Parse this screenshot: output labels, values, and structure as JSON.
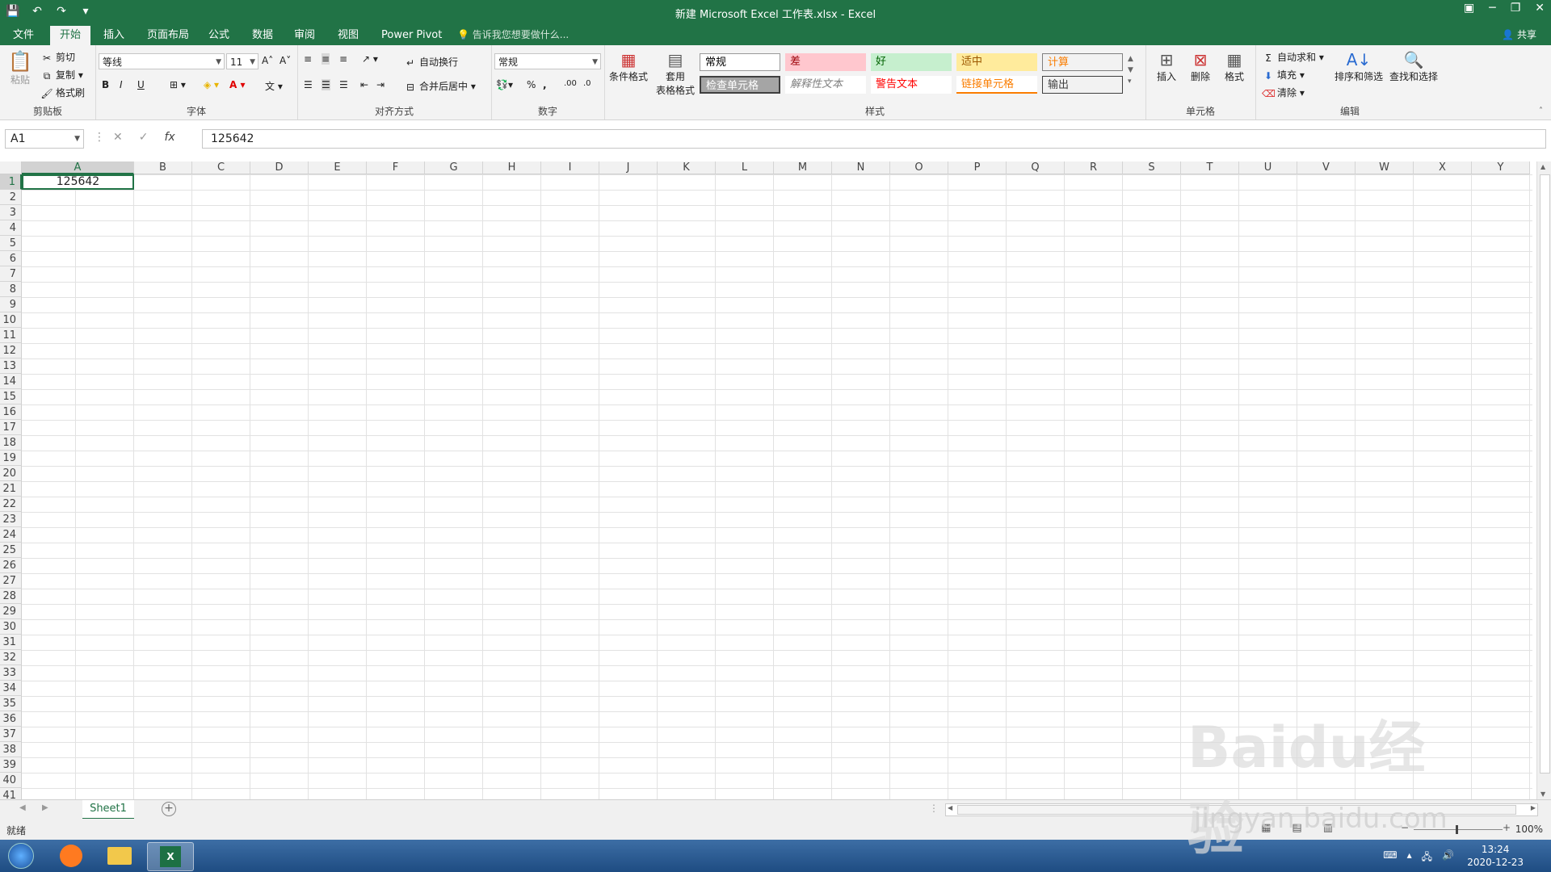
{
  "titlebar": {
    "title": "新建 Microsoft Excel 工作表.xlsx - Excel",
    "qat": [
      "save-icon",
      "undo-icon",
      "redo-icon",
      "customize-icon"
    ],
    "controls": [
      "ribbon-display-icon",
      "minimize-icon",
      "restore-icon",
      "close-icon"
    ]
  },
  "tabs": [
    {
      "label": "文件",
      "active": false
    },
    {
      "label": "开始",
      "active": true
    },
    {
      "label": "插入",
      "active": false
    },
    {
      "label": "页面布局",
      "active": false
    },
    {
      "label": "公式",
      "active": false
    },
    {
      "label": "数据",
      "active": false
    },
    {
      "label": "审阅",
      "active": false
    },
    {
      "label": "视图",
      "active": false
    },
    {
      "label": "Power Pivot",
      "active": false
    }
  ],
  "tellme": "告诉我您想要做什么...",
  "share": "共享",
  "ribbon": {
    "clipboard": {
      "label": "剪贴板",
      "paste": "粘贴",
      "cut": "剪切",
      "copy": "复制",
      "format_painter": "格式刷"
    },
    "font": {
      "label": "字体",
      "name": "等线",
      "size": "11",
      "bold": "B",
      "italic": "I",
      "underline": "U"
    },
    "alignment": {
      "label": "对齐方式",
      "wrap": "自动换行",
      "merge": "合并后居中"
    },
    "number": {
      "label": "数字",
      "format": "常规",
      "percent": "%",
      "comma": ","
    },
    "styles": {
      "label": "样式",
      "cond_format": "条件格式",
      "table_format_1": "套用",
      "table_format_2": "表格格式",
      "boxes": [
        {
          "text": "常规",
          "bg": "#ffffff",
          "fg": "#000000"
        },
        {
          "text": "差",
          "bg": "#ffc7ce",
          "fg": "#9c0006"
        },
        {
          "text": "好",
          "bg": "#c6efce",
          "fg": "#006100"
        },
        {
          "text": "适中",
          "bg": "#ffeb9c",
          "fg": "#9c5700"
        },
        {
          "text": "计算",
          "bg": "#f2f2f2",
          "fg": "#fa7d00"
        },
        {
          "text": "检查单元格",
          "bg": "#a5a5a5",
          "fg": "#ffffff"
        },
        {
          "text": "解释性文本",
          "bg": "#ffffff",
          "fg": "#7f7f7f"
        },
        {
          "text": "警告文本",
          "bg": "#ffffff",
          "fg": "#ff0000"
        },
        {
          "text": "链接单元格",
          "bg": "#ffffff",
          "fg": "#fa7d00"
        },
        {
          "text": "输出",
          "bg": "#f2f2f2",
          "fg": "#3f3f3f"
        }
      ]
    },
    "cells": {
      "label": "单元格",
      "insert": "插入",
      "delete": "删除",
      "format": "格式"
    },
    "editing": {
      "label": "编辑",
      "autosum": "自动求和",
      "fill": "填充",
      "clear": "清除",
      "sort": "排序和筛选",
      "find": "查找和选择"
    }
  },
  "formula_bar": {
    "name_box": "A1",
    "cancel": "✕",
    "enter": "✓",
    "fx": "fx",
    "value": "125642"
  },
  "columns": [
    "A",
    "B",
    "C",
    "D",
    "E",
    "F",
    "G",
    "H",
    "I",
    "J",
    "K",
    "L",
    "M",
    "N",
    "O",
    "P",
    "Q",
    "R",
    "S",
    "T",
    "U",
    "V",
    "W",
    "X",
    "Y"
  ],
  "rows": [
    "1",
    "2",
    "3",
    "4",
    "5",
    "6",
    "7",
    "8",
    "9",
    "10",
    "11",
    "12",
    "13",
    "14",
    "15",
    "16",
    "17",
    "18",
    "19",
    "20",
    "21",
    "22",
    "23",
    "24",
    "25",
    "26",
    "27",
    "28",
    "29",
    "30",
    "31",
    "32",
    "33",
    "34",
    "35",
    "36",
    "37",
    "38",
    "39",
    "40",
    "41"
  ],
  "cell_a1": "125642",
  "sheet_tab": "Sheet1",
  "status": {
    "ready": "就绪",
    "zoom": "100%"
  },
  "taskbar": {
    "time": "13:24",
    "date": "2020-12-23"
  },
  "watermark": {
    "main": "Baidu经验",
    "sub": "jingyan.baidu.com"
  }
}
